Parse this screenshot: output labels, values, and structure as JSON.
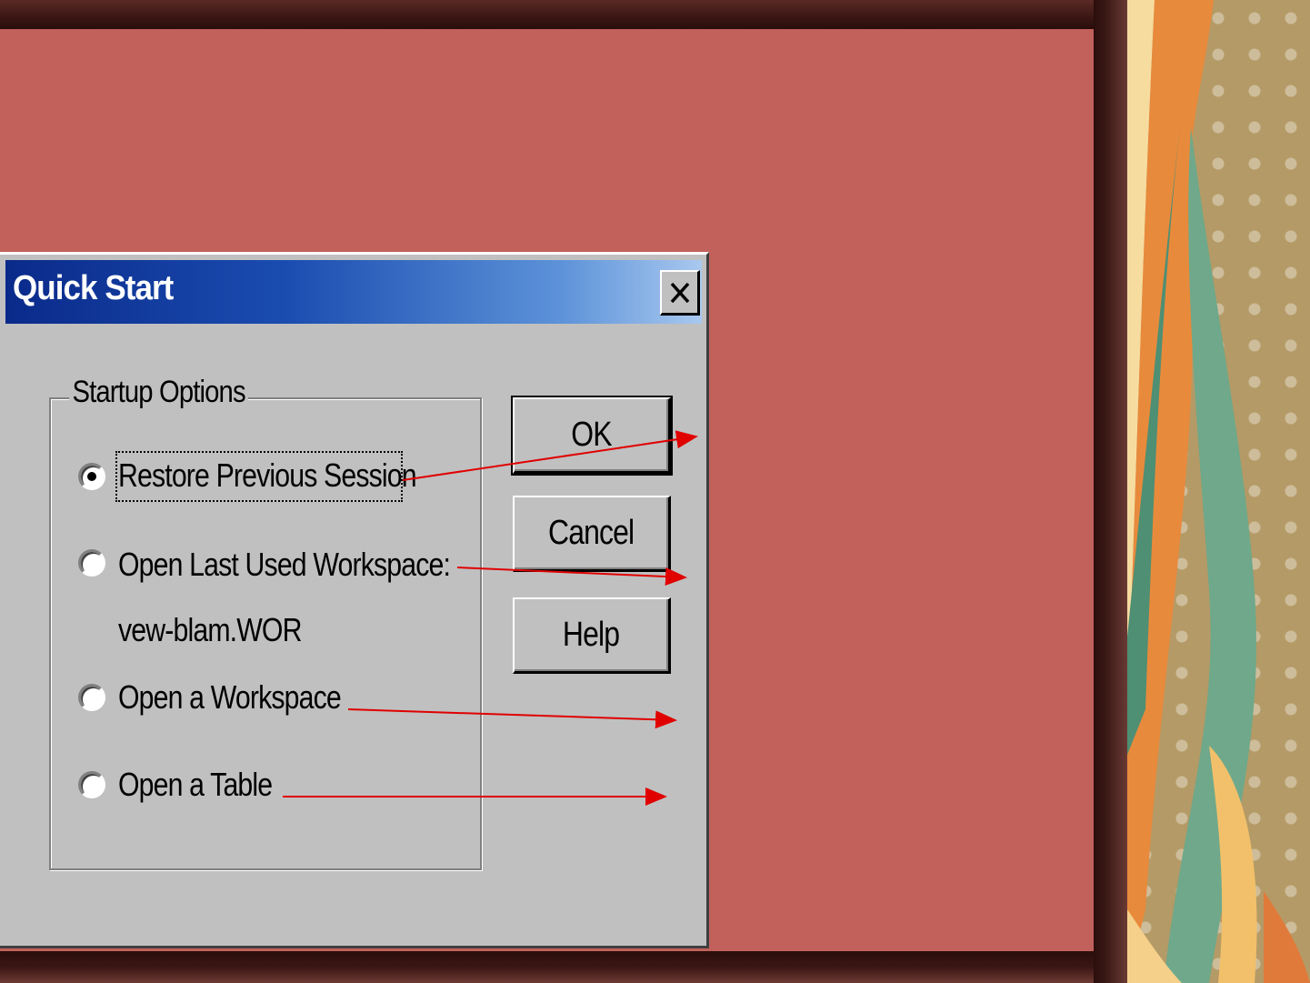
{
  "dialog": {
    "title": "Quick Start",
    "close_icon": "close-x-icon"
  },
  "group": {
    "label": "Startup Options",
    "options": [
      {
        "label": "Restore Previous Session",
        "selected": true
      },
      {
        "label": "Open Last Used Workspace:",
        "selected": false
      },
      {
        "label": "Open a Workspace",
        "selected": false
      },
      {
        "label": "Open a Table",
        "selected": false
      }
    ],
    "workspace_file": "vew-blam.WOR"
  },
  "buttons": {
    "ok": "OK",
    "cancel": "Cancel",
    "help": "Help"
  },
  "colors": {
    "slide_background": "#c2615b",
    "dialog_face": "#c0c0c0",
    "titlebar_start": "#0a2a8a",
    "titlebar_end": "#a8c8ef",
    "arrow": "#e00000"
  }
}
